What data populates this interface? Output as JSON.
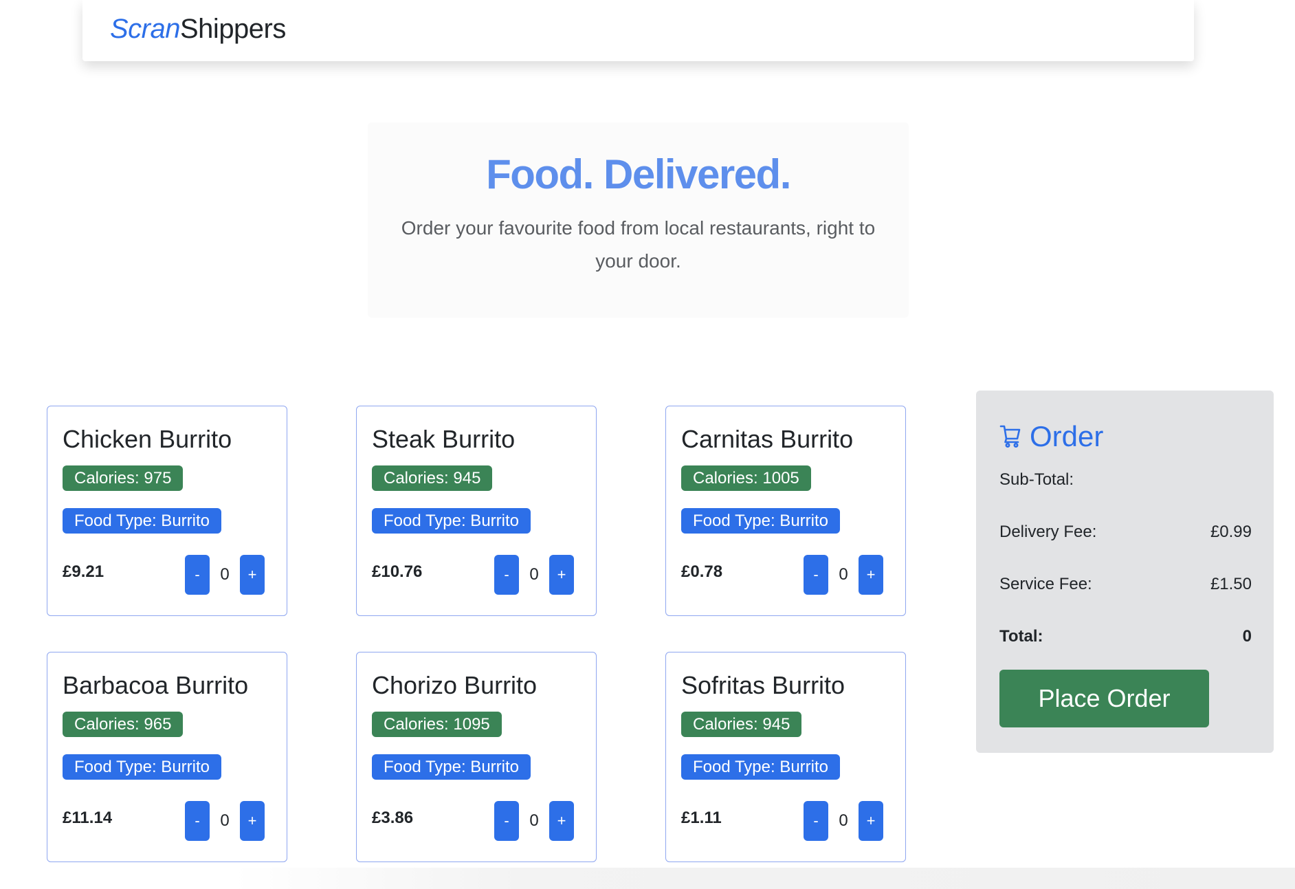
{
  "navbar": {
    "brand_part1": "Scran",
    "brand_part2": "Shippers"
  },
  "hero": {
    "title": "Food. Delivered.",
    "subtitle": "Order your favourite food from local restaurants, right to your door."
  },
  "products": [
    {
      "name": "Chicken Burrito",
      "calories": "Calories: 975",
      "food_type": "Food Type: Burrito",
      "price": "£9.21",
      "qty": "0",
      "minus": "-",
      "plus": "+"
    },
    {
      "name": "Steak Burrito",
      "calories": "Calories: 945",
      "food_type": "Food Type: Burrito",
      "price": "£10.76",
      "qty": "0",
      "minus": "-",
      "plus": "+"
    },
    {
      "name": "Carnitas Burrito",
      "calories": "Calories: 1005",
      "food_type": "Food Type: Burrito",
      "price": "£0.78",
      "qty": "0",
      "minus": "-",
      "plus": "+"
    },
    {
      "name": "Barbacoa Burrito",
      "calories": "Calories: 965",
      "food_type": "Food Type: Burrito",
      "price": "£11.14",
      "qty": "0",
      "minus": "-",
      "plus": "+"
    },
    {
      "name": "Chorizo Burrito",
      "calories": "Calories: 1095",
      "food_type": "Food Type: Burrito",
      "price": "£3.86",
      "qty": "0",
      "minus": "-",
      "plus": "+"
    },
    {
      "name": "Sofritas Burrito",
      "calories": "Calories: 945",
      "food_type": "Food Type: Burrito",
      "price": "£1.11",
      "qty": "0",
      "minus": "-",
      "plus": "+"
    }
  ],
  "order": {
    "icon": "cart-icon",
    "title": "Order",
    "subtotal_label": "Sub-Total:",
    "subtotal_value": "",
    "delivery_label": "Delivery Fee:",
    "delivery_value": "£0.99",
    "service_label": "Service Fee:",
    "service_value": "£1.50",
    "total_label": "Total:",
    "total_value": "0",
    "place_order_label": "Place Order"
  },
  "colors": {
    "primary": "#2d6fe8",
    "success": "#3b8456",
    "hero_title": "#5e8fec",
    "order_panel_bg": "#e2e3e5"
  }
}
